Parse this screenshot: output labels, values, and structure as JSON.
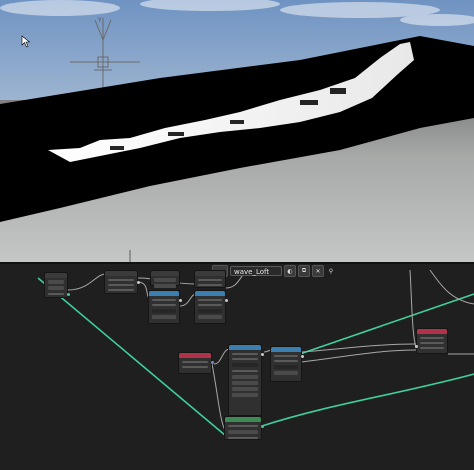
{
  "node_editor": {
    "header": {
      "node_tree_name": "wave_Loft",
      "icons": [
        "node-tree-icon",
        "shield-icon",
        "copy-icon",
        "close-icon",
        "pin-icon"
      ]
    },
    "colors": {
      "sky_top": "#7e9fc6",
      "sky_bottom": "#c8d4e0",
      "wire_green": "#3fcf9a",
      "wire_gray": "#aaaaaa",
      "node_body": "#303030",
      "header_blue": "#3a7fb0",
      "header_red": "#b0334a",
      "header_green": "#3d8a55",
      "header_dark": "#3b3b3b"
    }
  }
}
